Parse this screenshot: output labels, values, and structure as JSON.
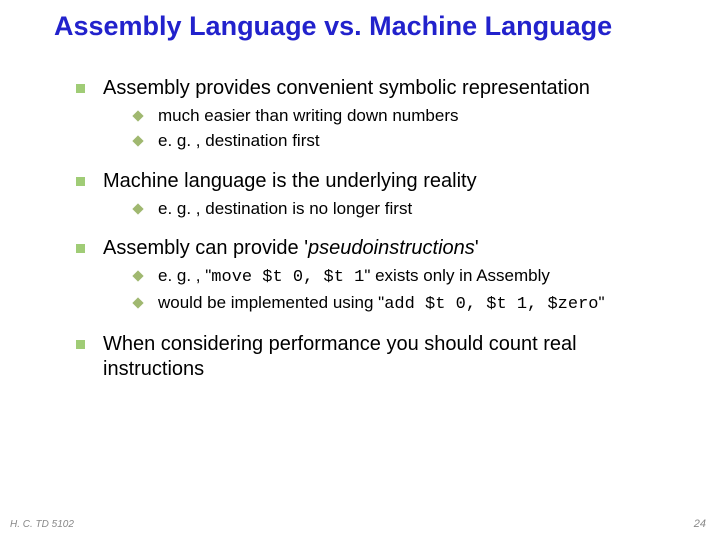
{
  "title": "Assembly Language vs. Machine Language",
  "bullets": {
    "b1": "Assembly provides convenient symbolic representation",
    "b1_1": "much easier than writing down numbers",
    "b1_2": "e. g. , destination first",
    "b2": "Machine language is the underlying reality",
    "b2_1": "e. g. , destination is no longer first",
    "b3_pre": "Assembly can provide '",
    "b3_italic": "pseudoinstructions",
    "b3_post": "'",
    "b3_1_pre": "e. g. , \"",
    "b3_1_code": "move $t 0, $t 1",
    "b3_1_post": "\" exists only in Assembly",
    "b3_2_pre": "would be implemented using \"",
    "b3_2_code": "add $t 0, $t 1, $zero",
    "b3_2_post": "\"",
    "b4": "When considering performance you should count real instructions"
  },
  "footer": {
    "left": "H. C. TD 5102",
    "right": "24"
  }
}
